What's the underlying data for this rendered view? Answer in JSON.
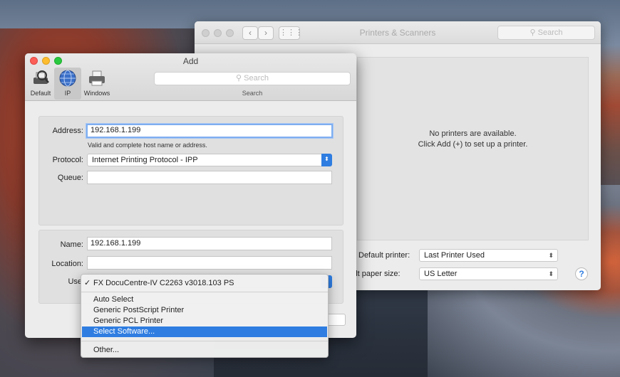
{
  "printers_window": {
    "title": "Printers & Scanners",
    "search_placeholder": "Search",
    "empty_line1": "No printers are available.",
    "empty_line2": "Click Add (+) to set up a printer.",
    "default_printer_label": "Default printer:",
    "default_printer_value": "Last Printer Used",
    "paper_size_label": "ault paper size:",
    "paper_size_value": "US Letter",
    "help_label": "?"
  },
  "add_window": {
    "title": "Add",
    "toolbar": [
      {
        "label": "Default",
        "icon": "default-printer-icon"
      },
      {
        "label": "IP",
        "icon": "ip-globe-icon"
      },
      {
        "label": "Windows",
        "icon": "windows-printer-icon"
      }
    ],
    "search_placeholder": "Search",
    "search_label": "Search",
    "address_label": "Address:",
    "address_value": "192.168.1.199",
    "address_hint": "Valid and complete host name or address.",
    "protocol_label": "Protocol:",
    "protocol_value": "Internet Printing Protocol - IPP",
    "queue_label": "Queue:",
    "queue_value": "",
    "name_label": "Name:",
    "name_value": "192.168.1.199",
    "location_label": "Location:",
    "location_value": "",
    "use_label": "Use"
  },
  "use_menu": {
    "current": "FX DocuCentre-IV C2263 v3018.103 PS",
    "check": "✓",
    "items": [
      "Auto Select",
      "Generic PostScript Printer",
      "Generic PCL Printer",
      "Select Software..."
    ],
    "other": "Other...",
    "highlighted_index": 3
  },
  "colors": {
    "accent": "#2f7de1",
    "close": "#fc5f57",
    "minimize": "#fdbd2e",
    "zoom": "#29c940"
  }
}
